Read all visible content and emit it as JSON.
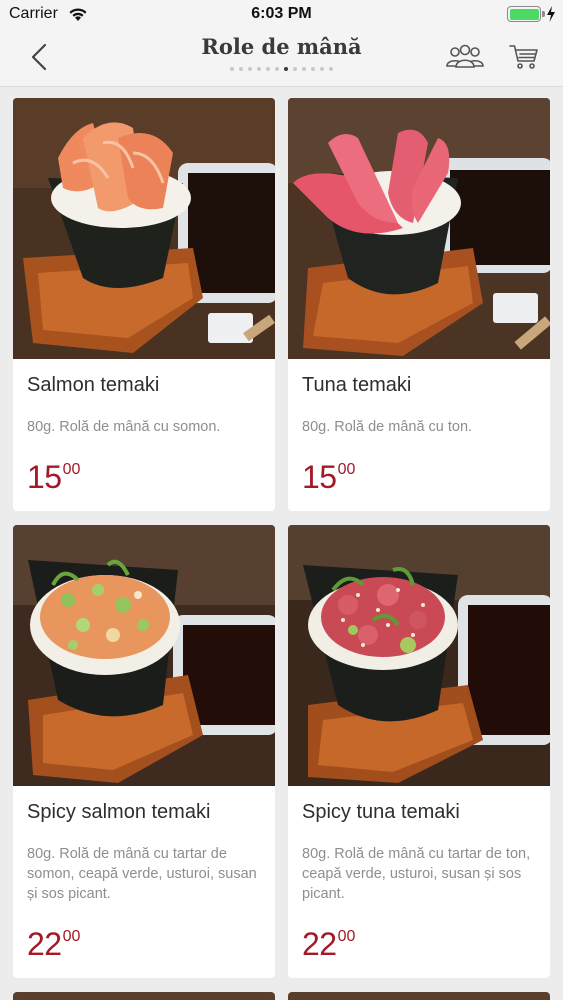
{
  "status_bar": {
    "carrier": "Carrier",
    "time": "6:03 PM",
    "battery_level": 1.0
  },
  "nav": {
    "title": "Role de mână",
    "page_count": 12,
    "active_page": 7,
    "back_icon": "chevron-left-icon",
    "group_icon": "people-group-icon",
    "cart_icon": "shopping-cart-icon"
  },
  "colors": {
    "accent_price": "#a31927",
    "battery": "#4cd964",
    "background": "#ececec"
  },
  "products": [
    {
      "name": "Salmon temaki",
      "description": "80g. Rolă de mână cu somon.",
      "price_int": "15",
      "price_dec": "00",
      "image": "salmon-temaki-photo"
    },
    {
      "name": "Tuna temaki",
      "description": "80g. Rolă de mână cu ton.",
      "price_int": "15",
      "price_dec": "00",
      "image": "tuna-temaki-photo"
    },
    {
      "name": "Spicy salmon temaki",
      "description": "80g. Rolă de mână cu tartar de somon, ceapă verde, usturoi, susan și sos picant.",
      "price_int": "22",
      "price_dec": "00",
      "image": "spicy-salmon-temaki-photo"
    },
    {
      "name": "Spicy tuna temaki",
      "description": "80g. Rolă de mână cu tartar de ton, ceapă verde, usturoi, susan și sos picant.",
      "price_int": "22",
      "price_dec": "00",
      "image": "spicy-tuna-temaki-photo"
    }
  ]
}
